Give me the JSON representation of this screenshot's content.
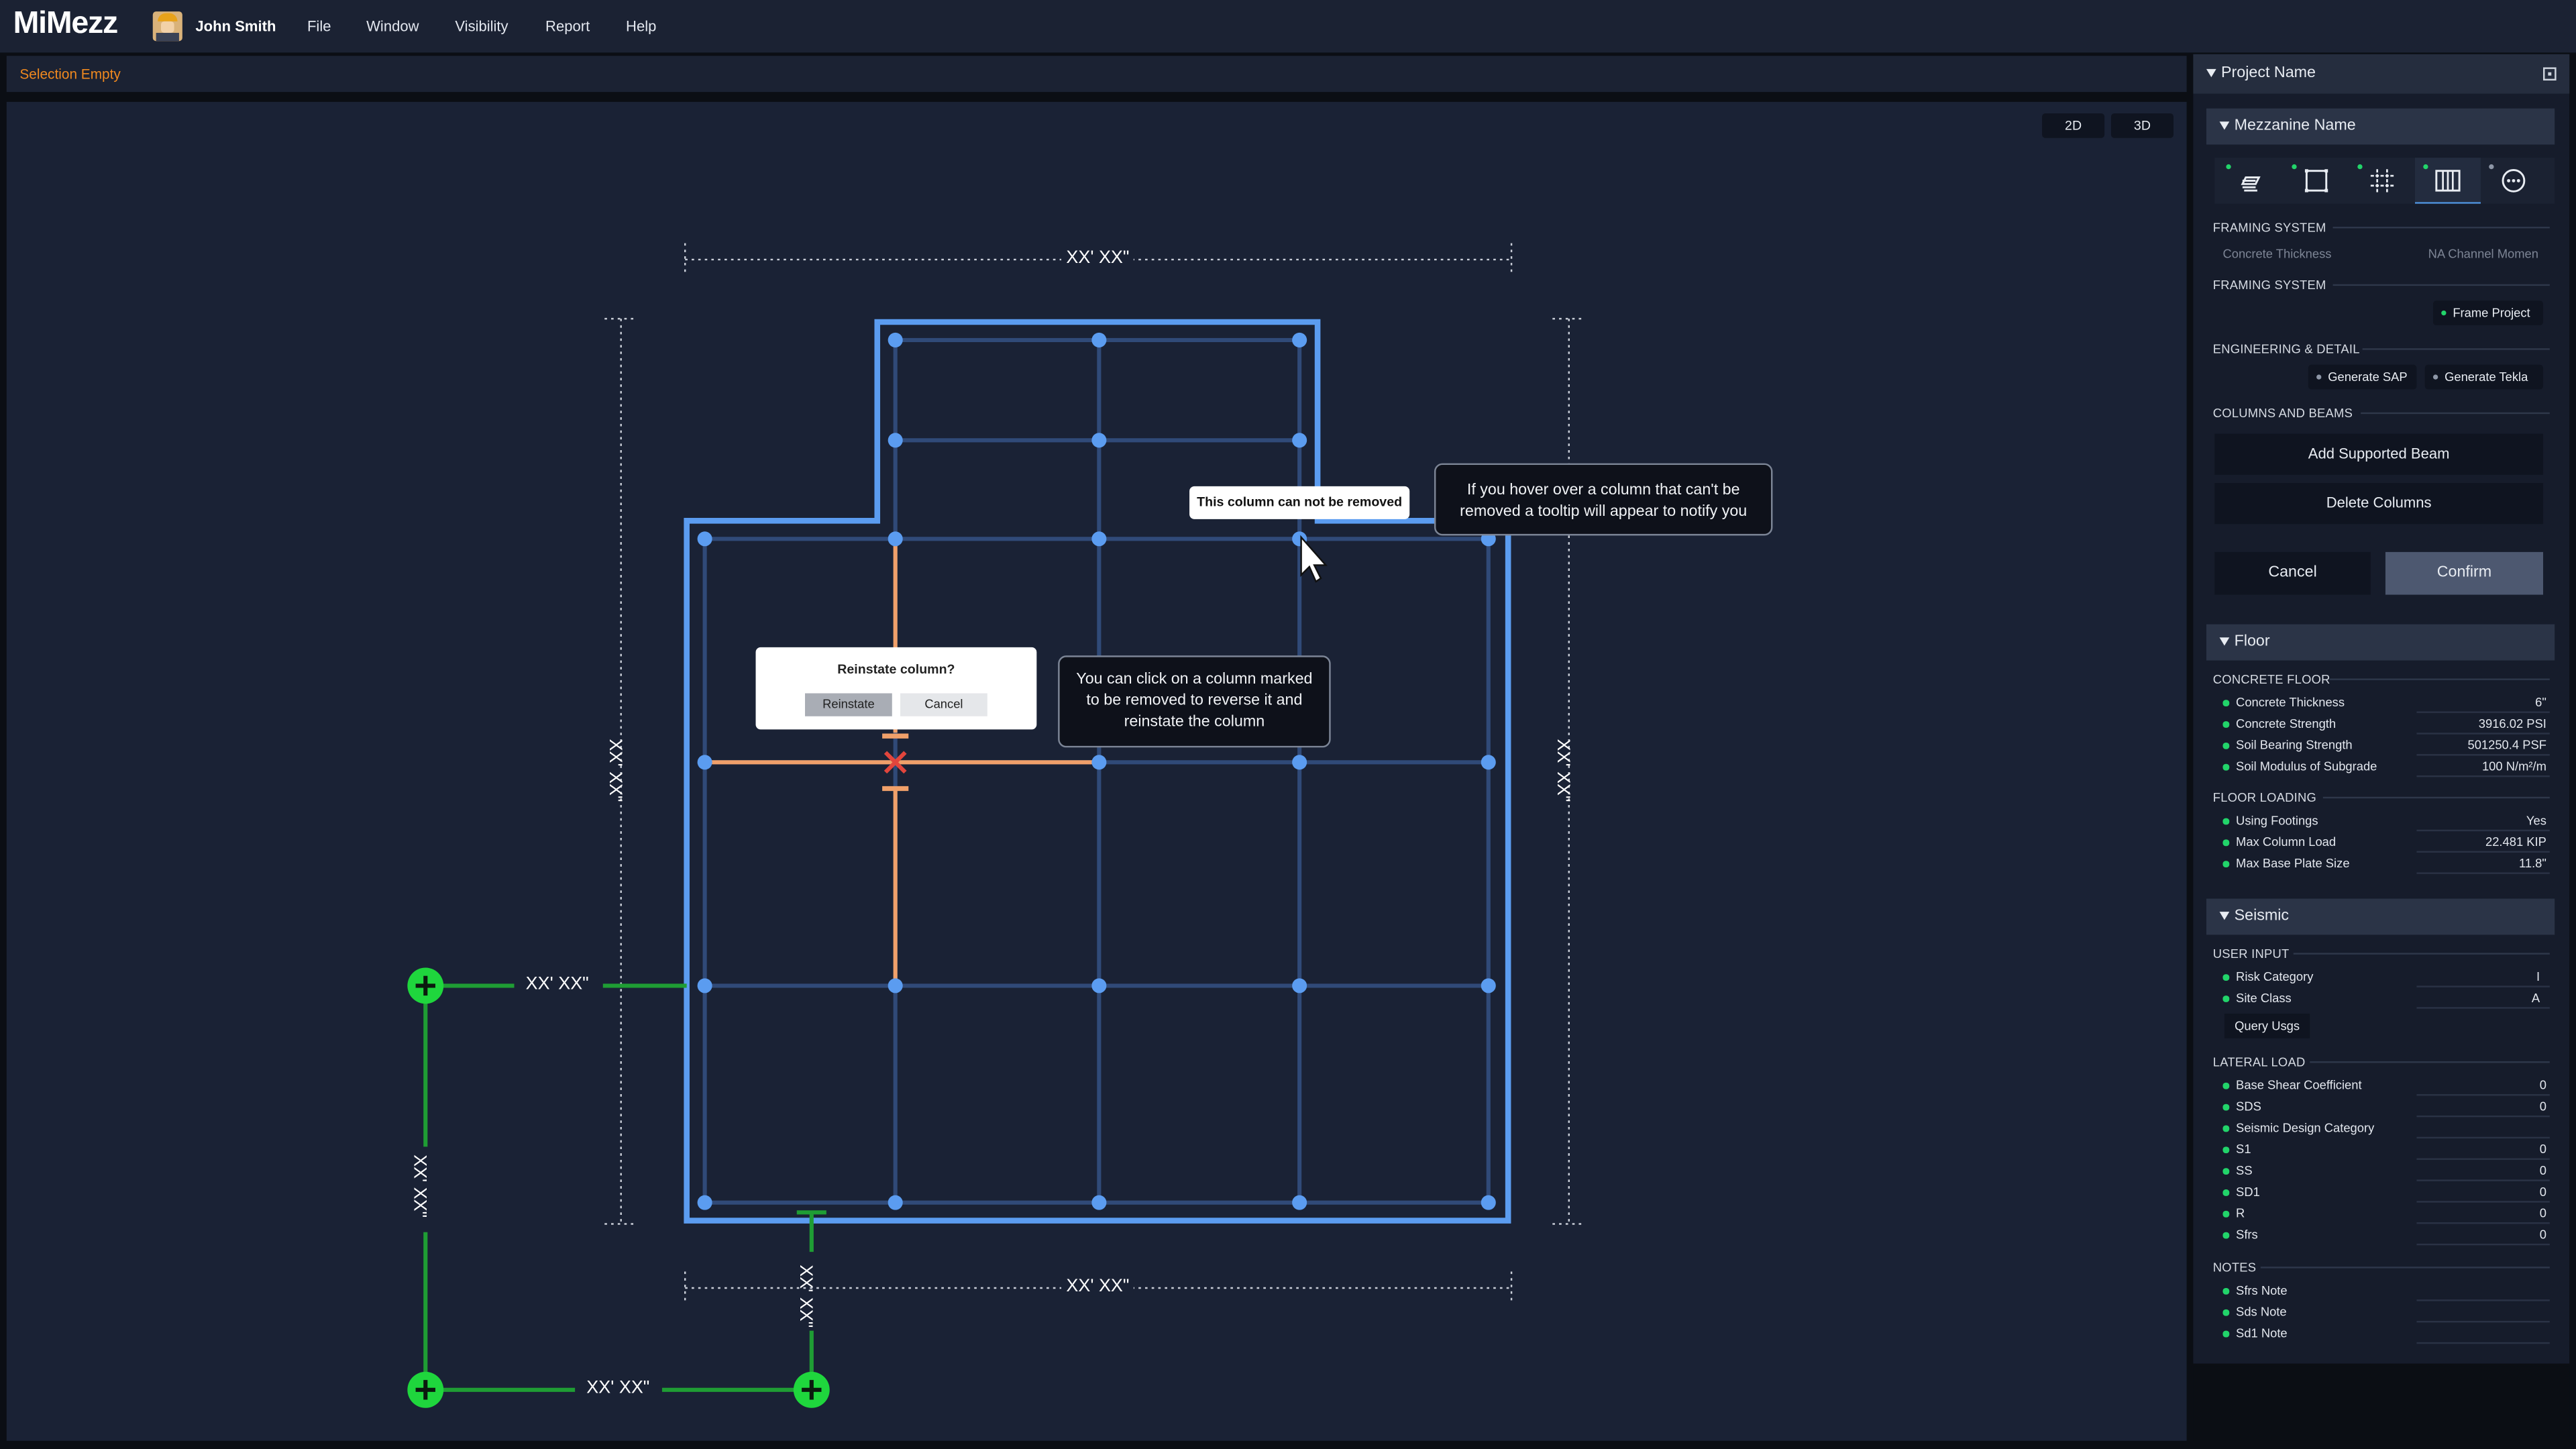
{
  "app": {
    "name": "MiMezz",
    "user": "John Smith"
  },
  "menu": [
    "File",
    "Window",
    "Visibility",
    "Report",
    "Help"
  ],
  "status": "Selection Empty",
  "view_toggle": {
    "two_d": "2D",
    "three_d": "3D"
  },
  "plan": {
    "dims": {
      "top": "XX' XX\"",
      "bottom": "XX' XX\"",
      "left": "XX' XX\"",
      "right": "XX' XX\""
    },
    "green_dims": {
      "upper": "XX' XX\"",
      "lower": "XX' XX\"",
      "vertical_left": "XX' XX\"",
      "vertical_mid": "XX' XX\""
    },
    "tooltip_not_removed": "This column can not be removed",
    "callout_hover": "If you hover over a column that can't be removed a tooltip will appear to notify you",
    "callout_click": "You can click on a column marked to be removed to reverse it and reinstate the column",
    "dialog": {
      "question": "Reinstate column?",
      "confirm": "Reinstate",
      "cancel": "Cancel"
    }
  },
  "panel": {
    "project": "Project Name",
    "mezzanine": "Mezzanine Name",
    "tool_icons": [
      "layers-icon",
      "frame-icon",
      "grid-icon",
      "columns-icon",
      "more-icon"
    ],
    "framing1": {
      "label": "FRAMING SYSTEM",
      "left": "Concrete Thickness",
      "right": "NA Channel Momen"
    },
    "framing2": {
      "label": "FRAMING SYSTEM",
      "button": "Frame Project"
    },
    "engineering": {
      "label": "ENGINEERING & DETAIL",
      "sap": "Generate SAP",
      "tekla": "Generate Tekla"
    },
    "columns_beams": {
      "label": "COLUMNS AND BEAMS",
      "add": "Add Supported Beam",
      "delete": "Delete Columns"
    },
    "cancel": "Cancel",
    "confirm": "Confirm",
    "floor": {
      "title": "Floor",
      "concrete_label": "CONCRETE FLOOR",
      "concrete": [
        {
          "label": "Concrete Thickness",
          "value": "6\""
        },
        {
          "label": "Concrete Strength",
          "value": "3916.02 PSI"
        },
        {
          "label": "Soil Bearing Strength",
          "value": "501250.4 PSF"
        },
        {
          "label": "Soil Modulus of Subgrade",
          "value": "100 N/m²/m"
        }
      ],
      "loading_label": "FLOOR LOADING",
      "loading": [
        {
          "label": "Using Footings",
          "value": "Yes"
        },
        {
          "label": "Max Column Load",
          "value": "22.481 KIP"
        },
        {
          "label": "Max Base Plate Size",
          "value": "11.8\""
        }
      ]
    },
    "seismic": {
      "title": "Seismic",
      "user_input_label": "USER INPUT",
      "user_input": [
        {
          "label": "Risk Category",
          "value": "I"
        },
        {
          "label": "Site Class",
          "value": "A"
        }
      ],
      "query": "Query Usgs",
      "lateral_label": "LATERAL LOAD",
      "lateral": [
        {
          "label": "Base Shear Coefficient",
          "value": "0"
        },
        {
          "label": "SDS",
          "value": "0"
        },
        {
          "label": "Seismic Design Category",
          "value": ""
        },
        {
          "label": "S1",
          "value": "0"
        },
        {
          "label": "SS",
          "value": "0"
        },
        {
          "label": "SD1",
          "value": "0"
        },
        {
          "label": "R",
          "value": "0"
        },
        {
          "label": "Sfrs",
          "value": "0"
        }
      ],
      "notes_label": "NOTES",
      "notes": [
        {
          "label": "Sfrs Note",
          "value": ""
        },
        {
          "label": "Sds Note",
          "value": ""
        },
        {
          "label": "Sd1 Note",
          "value": ""
        }
      ]
    }
  },
  "colors": {
    "accent": "#f0891f",
    "selection": "#4d8fd8",
    "node": "#5b9cf0",
    "grid": "#304a78",
    "removed": "#f0a06a",
    "green": "#1fd63d",
    "danger": "#e2453c"
  }
}
